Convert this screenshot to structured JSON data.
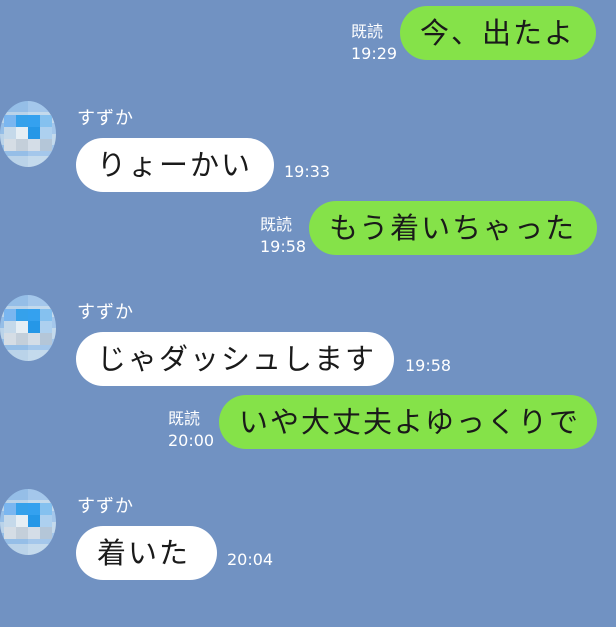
{
  "colors": {
    "background": "#7192c2",
    "incoming_bubble": "#ffffff",
    "outgoing_bubble": "#85e249",
    "meta_text": "#ffffff"
  },
  "messages": [
    {
      "direction": "out",
      "text": "今、出たよ",
      "read_label": "既読",
      "time": "19:29"
    },
    {
      "direction": "in",
      "sender": "すずか",
      "text": "りょーかい",
      "time": "19:33"
    },
    {
      "direction": "out",
      "text": "もう着いちゃった",
      "read_label": "既読",
      "time": "19:58"
    },
    {
      "direction": "in",
      "sender": "すずか",
      "text": "じゃダッシュします",
      "time": "19:58"
    },
    {
      "direction": "out",
      "text": "いや大丈夫よゆっくりで",
      "read_label": "既読",
      "time": "20:00"
    },
    {
      "direction": "in",
      "sender": "すずか",
      "text": "着いた",
      "time": "20:04"
    }
  ]
}
